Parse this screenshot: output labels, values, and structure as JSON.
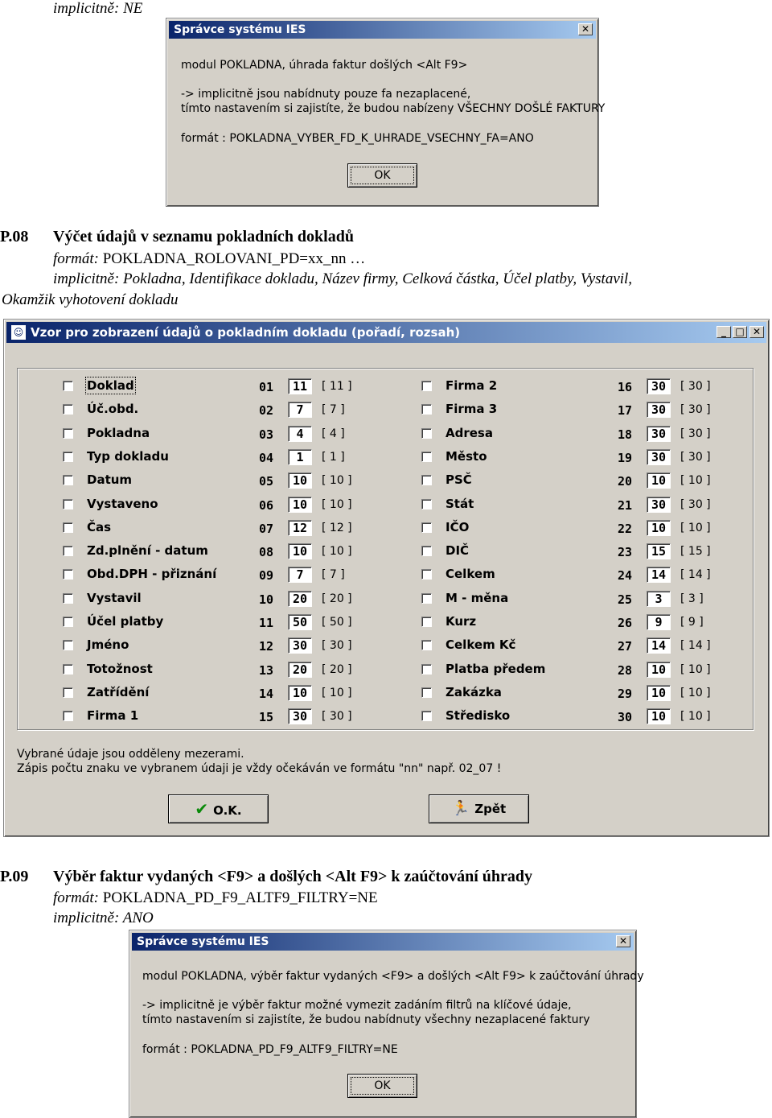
{
  "top_line": {
    "label": "implicitně:",
    "value": "NE"
  },
  "dialog1": {
    "title": "Správce systému IES",
    "line1": "modul POKLADNA, úhrada faktur došlých <Alt F9>",
    "line2": "-> implicitně jsou nabídnuty pouze fa nezaplacené,",
    "line3": "tímto nastavením si zajistíte, že budou nabízeny VŠECHNY DOŠLÉ FAKTURY",
    "line4": "formát : POKLADNA_VYBER_FD_K_UHRADE_VSECHNY_FA=ANO",
    "ok": "OK"
  },
  "section08": {
    "num": "P.08",
    "heading": "Výčet údajů v seznamu pokladních dokladů",
    "format_label": "formát:",
    "format_value": "POKLADNA_ROLOVANI_PD=xx_nn …",
    "implicit_line1": "implicitně: Pokladna, Identifikace dokladu, Název firmy, Celková částka, Účel platby, Vystavil,",
    "implicit_line2": "Okamžik vyhotovení dokladu"
  },
  "window": {
    "title": "Vzor pro zobrazení údajů o pokladním dokladu (pořadí, rozsah)",
    "left": [
      {
        "label": "Doklad",
        "n": "01",
        "v": "11",
        "d": "[ 11 ]"
      },
      {
        "label": "Úč.obd.",
        "n": "02",
        "v": "7",
        "d": "[ 7 ]"
      },
      {
        "label": "Pokladna",
        "n": "03",
        "v": "4",
        "d": "[ 4 ]"
      },
      {
        "label": "Typ dokladu",
        "n": "04",
        "v": "1",
        "d": "[ 1 ]"
      },
      {
        "label": "Datum",
        "n": "05",
        "v": "10",
        "d": "[ 10 ]"
      },
      {
        "label": "Vystaveno",
        "n": "06",
        "v": "10",
        "d": "[ 10 ]"
      },
      {
        "label": "Čas",
        "n": "07",
        "v": "12",
        "d": "[ 12 ]"
      },
      {
        "label": "Zd.plnění - datum",
        "n": "08",
        "v": "10",
        "d": "[ 10 ]"
      },
      {
        "label": "Obd.DPH - přiznání",
        "n": "09",
        "v": "7",
        "d": "[ 7 ]"
      },
      {
        "label": "Vystavil",
        "n": "10",
        "v": "20",
        "d": "[ 20 ]"
      },
      {
        "label": "Účel platby",
        "n": "11",
        "v": "50",
        "d": "[ 50 ]"
      },
      {
        "label": "Jméno",
        "n": "12",
        "v": "30",
        "d": "[ 30 ]"
      },
      {
        "label": "Totožnost",
        "n": "13",
        "v": "20",
        "d": "[ 20 ]"
      },
      {
        "label": "Zatřídění",
        "n": "14",
        "v": "10",
        "d": "[ 10 ]"
      },
      {
        "label": "Firma 1",
        "n": "15",
        "v": "30",
        "d": "[ 30 ]"
      }
    ],
    "right": [
      {
        "label": "Firma 2",
        "n": "16",
        "v": "30",
        "d": "[ 30 ]"
      },
      {
        "label": "Firma 3",
        "n": "17",
        "v": "30",
        "d": "[ 30 ]"
      },
      {
        "label": "Adresa",
        "n": "18",
        "v": "30",
        "d": "[ 30 ]"
      },
      {
        "label": "Město",
        "n": "19",
        "v": "30",
        "d": "[ 30 ]"
      },
      {
        "label": "PSČ",
        "n": "20",
        "v": "10",
        "d": "[ 10 ]"
      },
      {
        "label": "Stát",
        "n": "21",
        "v": "30",
        "d": "[ 30 ]"
      },
      {
        "label": "IČO",
        "n": "22",
        "v": "10",
        "d": "[ 10 ]"
      },
      {
        "label": "DIČ",
        "n": "23",
        "v": "15",
        "d": "[ 15 ]"
      },
      {
        "label": "Celkem",
        "n": "24",
        "v": "14",
        "d": "[ 14 ]"
      },
      {
        "label": "M - měna",
        "n": "25",
        "v": "3",
        "d": "[ 3 ]"
      },
      {
        "label": "Kurz",
        "n": "26",
        "v": "9",
        "d": "[ 9 ]"
      },
      {
        "label": "Celkem Kč",
        "n": "27",
        "v": "14",
        "d": "[ 14 ]"
      },
      {
        "label": "Platba předem",
        "n": "28",
        "v": "10",
        "d": "[ 10 ]"
      },
      {
        "label": "Zakázka",
        "n": "29",
        "v": "10",
        "d": "[ 10 ]"
      },
      {
        "label": "Středisko",
        "n": "30",
        "v": "10",
        "d": "[ 10 ]"
      }
    ],
    "note1": "Vybrané údaje jsou odděleny mezerami.",
    "note2": "Zápis počtu znaku ve vybranem údaji je vždy očekáván ve formátu \"nn\" např. 02_07 !",
    "ok": "O.K.",
    "back": "Zpět"
  },
  "section09": {
    "num": "P.09",
    "heading": "Výběr faktur vydaných <F9> a došlých <Alt F9> k zaúčtování úhrady",
    "format_label": "formát:",
    "format_value": "POKLADNA_PD_F9_ALTF9_FILTRY=NE",
    "implicit_label": "implicitně:",
    "implicit_value": "ANO"
  },
  "dialog2": {
    "title": "Správce systému IES",
    "line1": "modul POKLADNA, výběr faktur vydaných <F9> a došlých <Alt F9> k zaúčtování úhrady",
    "line2": "-> implicitně je výběr faktur možné vymezit zadáním filtrů na klíčové údaje,",
    "line3": "tímto nastavením si zajistíte, že budou nabídnuty všechny nezaplacené faktury",
    "line4": "formát : POKLADNA_PD_F9_ALTF9_FILTRY=NE",
    "ok": "OK"
  }
}
